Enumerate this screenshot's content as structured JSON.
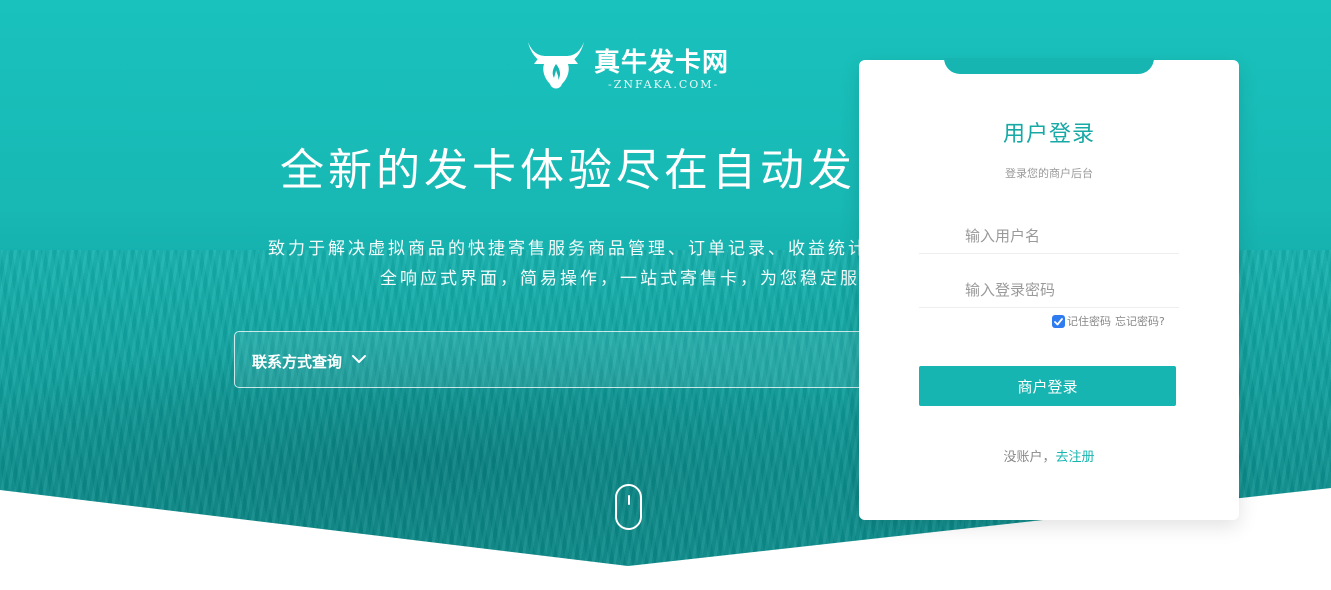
{
  "brand": {
    "name": "真牛发卡网",
    "domain": "-ZNFAKA.COM-",
    "icon": "bull-head-icon"
  },
  "hero": {
    "headline": "全新的发卡体验尽在自动发",
    "desc_line1": "致力于解决虚拟商品的快捷寄售服务商品管理、订单记录、收益统计",
    "desc_line2": "全响应式界面，简易操作，一站式寄售卡，为您稳定服",
    "query_label": "联系方式查询",
    "scroll_icon": "mouse-scroll-icon"
  },
  "login": {
    "title": "用户登录",
    "subtitle": "登录您的商户后台",
    "username_placeholder": "输入用户名",
    "password_placeholder": "输入登录密码",
    "remember_label": "记住密码",
    "remember_checked": true,
    "forgot_label": "忘记密码?",
    "submit_label": "商户登录",
    "no_account_text": "没账户，",
    "register_label": "去注册"
  },
  "colors": {
    "accent": "#16b5b1",
    "title": "#16a9a5",
    "checkbox": "#2f7bf0"
  }
}
